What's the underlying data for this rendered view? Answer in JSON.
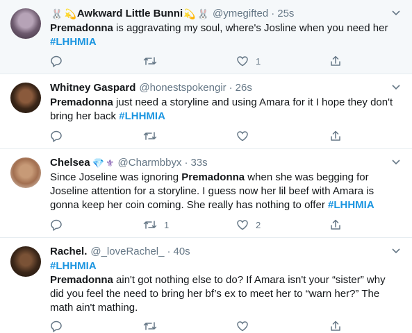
{
  "tweets": [
    {
      "name": "Awkward Little Bunni",
      "handle": "@ymegifted",
      "time": "25s",
      "text_bold": "Premadonna",
      "text_rest": " is aggravating my soul, where's Josline when you need her ",
      "hashtag": "#LHHMIA",
      "reply_count": "",
      "retweet_count": "",
      "like_count": "1"
    },
    {
      "name": "Whitney Gaspard",
      "handle": "@honestspokengir",
      "time": "26s",
      "text_bold": "Premadonna",
      "text_rest": " just need a storyline and using Amara for it I hope they don't bring her back ",
      "hashtag": "#LHHMIA",
      "reply_count": "",
      "retweet_count": "",
      "like_count": ""
    },
    {
      "name": "Chelsea",
      "handle": "@Charmbbyx",
      "time": "33s",
      "text_pre": "Since Joseline was ignoring ",
      "text_bold": "Premadonna",
      "text_rest": " when she was begging for Joseline attention for a storyline. I guess now her lil beef with Amara is gonna keep her coin coming. She really has nothing to offer ",
      "hashtag": "#LHHMIA",
      "reply_count": "",
      "retweet_count": "1",
      "like_count": "2"
    },
    {
      "name": "Rachel.",
      "handle": "@_loveRachel_",
      "time": "40s",
      "hashtag": "#LHHMIA",
      "text_bold": "Premadonna",
      "text_rest": " ain't got nothing else to do? If Amara isn't your “sister” why did you feel the need to bring her bf’s ex to meet her to “warn her?” The math ain't mathing.",
      "reply_count": "",
      "retweet_count": "",
      "like_count": ""
    }
  ],
  "separator": "·",
  "icons": [
    "reply-icon",
    "retweet-icon",
    "like-icon",
    "share-icon",
    "caret-down-icon"
  ],
  "colors": {
    "link": "#1b95e0",
    "muted": "#657786",
    "text": "#14171a"
  }
}
